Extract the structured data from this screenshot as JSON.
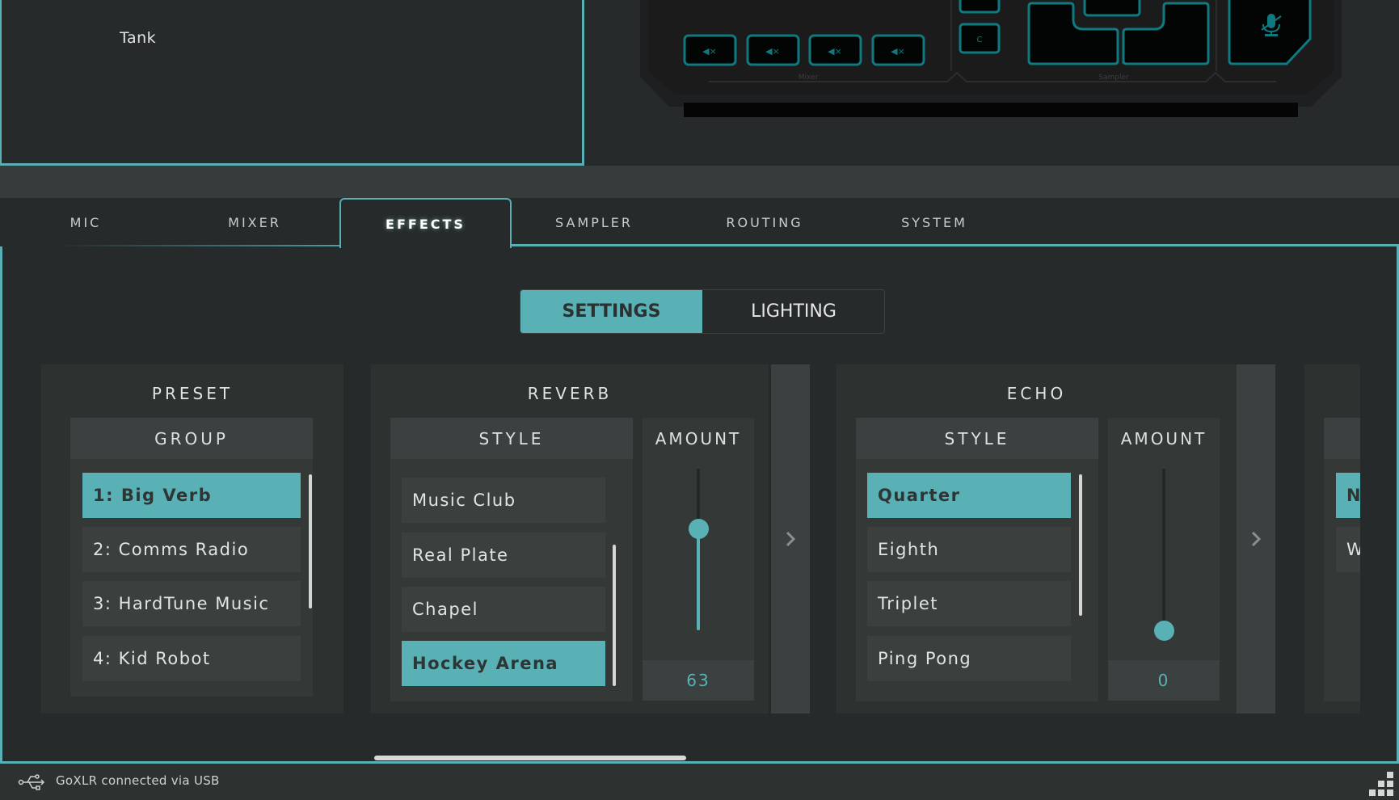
{
  "top_panel": {
    "preset_name": "Tank"
  },
  "device": {
    "section_labels": [
      "Mixer",
      "Sampler"
    ],
    "sampler_button_label": "C",
    "mute_buttons": [
      "mute-icon",
      "mute-icon",
      "mute-icon",
      "mute-icon"
    ],
    "mic_mute_icon": "mic-mute-icon",
    "accent_color": "#0e7a80"
  },
  "tabs": [
    {
      "label": "MIC",
      "active": false
    },
    {
      "label": "MIXER",
      "active": false
    },
    {
      "label": "EFFECTS",
      "active": true
    },
    {
      "label": "SAMPLER",
      "active": false
    },
    {
      "label": "ROUTING",
      "active": false
    },
    {
      "label": "SYSTEM",
      "active": false
    }
  ],
  "segmented": {
    "settings_label": "SETTINGS",
    "lighting_label": "LIGHTING",
    "active": "SETTINGS"
  },
  "preset": {
    "title": "PRESET",
    "group_label": "GROUP",
    "items": [
      "1: Big Verb",
      "2: Comms Radio",
      "3: HardTune Music",
      "4: Kid Robot"
    ],
    "selected": "1: Big Verb"
  },
  "reverb": {
    "title": "REVERB",
    "style_label": "STYLE",
    "amount_label": "AMOUNT",
    "styles": [
      "Music Club",
      "Real Plate",
      "Chapel",
      "Hockey Arena"
    ],
    "selected": "Hockey Arena",
    "amount": "63",
    "amount_fraction": 0.63
  },
  "echo": {
    "title": "ECHO",
    "style_label": "STYLE",
    "amount_label": "AMOUNT",
    "styles": [
      "Quarter",
      "Eighth",
      "Triplet",
      "Ping Pong"
    ],
    "selected": "Quarter",
    "amount": "0",
    "amount_fraction": 0.0
  },
  "next_panel_partial": {
    "items": [
      "N",
      "W"
    ]
  },
  "status": {
    "text": "GoXLR connected via USB",
    "icon": "usb-icon"
  },
  "colors": {
    "accent": "#59b0b5",
    "border": "#5aafb4",
    "background": "#262a2a",
    "panel": "#2d3231"
  }
}
